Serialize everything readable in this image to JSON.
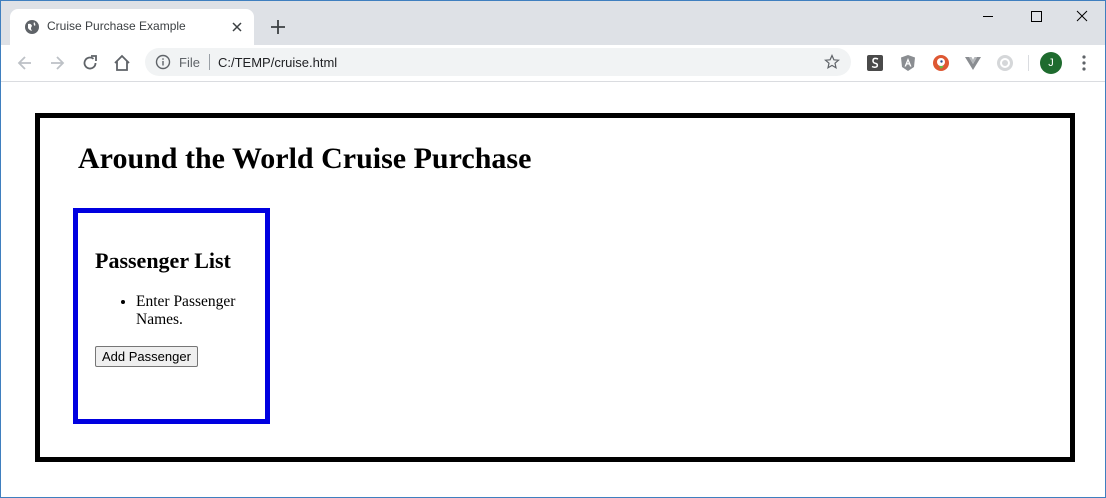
{
  "browser": {
    "tab_title": "Cruise Purchase Example",
    "omnibox_scheme": "File",
    "omnibox_url": "C:/TEMP/cruise.html",
    "profile_initial": "J",
    "icons": {
      "tab": "globe-icon",
      "close_tab": "close-icon",
      "new_tab": "plus-icon",
      "back": "back-arrow-icon",
      "forward": "forward-arrow-icon",
      "reload": "reload-icon",
      "home": "home-icon",
      "info": "info-icon",
      "bookmark": "star-icon",
      "menu": "kebab-menu-icon"
    },
    "extensions": [
      "stylus-extension-icon",
      "angular-extension-icon",
      "duckduckgo-extension-icon",
      "vue-extension-icon",
      "grey-circle-extension-icon"
    ],
    "colors": {
      "avatar": "#1e6b2e",
      "tabstrip": "#dee1e6"
    }
  },
  "page": {
    "heading": "Around the World Cruise Purchase",
    "passenger_section": {
      "heading": "Passenger List",
      "items": [
        "Enter Passenger Names."
      ],
      "add_button_label": "Add Passenger"
    },
    "colors": {
      "outer_border": "#000000",
      "passenger_border": "#0000e0"
    }
  }
}
